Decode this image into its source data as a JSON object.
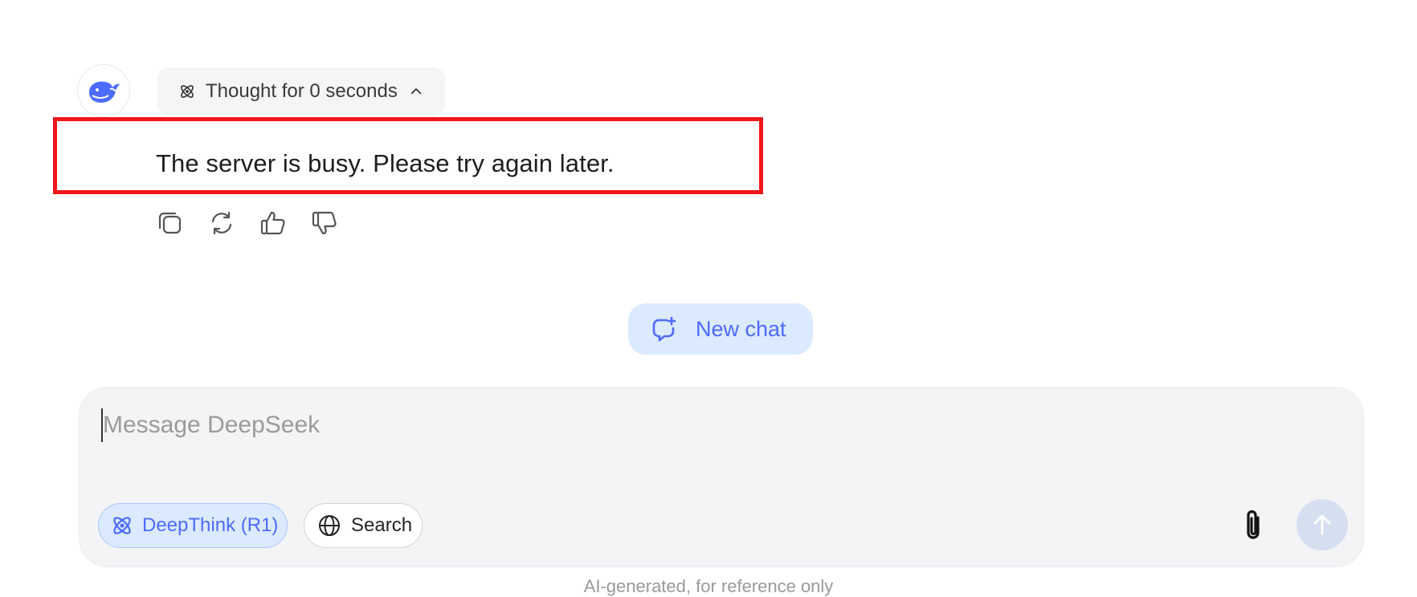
{
  "thinking": {
    "label": "Thought for 0 seconds"
  },
  "message": {
    "text": "The server is busy. Please try again later."
  },
  "new_chat": {
    "label": "New chat"
  },
  "composer": {
    "placeholder": "Message DeepSeek",
    "deepthink_label": "DeepThink (R1)",
    "search_label": "Search"
  },
  "footer": {
    "text": "AI-generated, for reference only"
  },
  "colors": {
    "accent": "#4d6bfe",
    "highlight": "#f0161b",
    "pill_bg": "#dbeafe"
  },
  "icons": [
    "deepseek-whale-icon",
    "atom-icon",
    "chevron-up-icon",
    "copy-icon",
    "regenerate-icon",
    "thumbs-up-icon",
    "thumbs-down-icon",
    "new-chat-icon",
    "globe-icon",
    "paperclip-icon",
    "arrow-up-icon"
  ]
}
